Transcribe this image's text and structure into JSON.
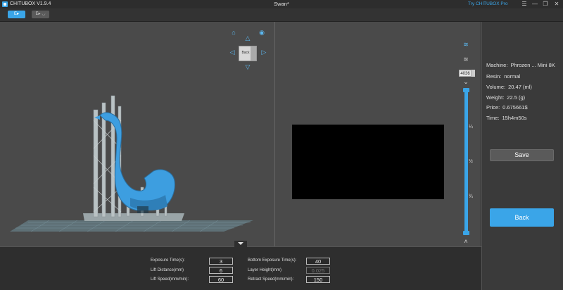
{
  "titlebar": {
    "app_name": "CHITUBOX V1.9.4",
    "doc_title": "Swan*",
    "try_pro": "Try CHITUBOX Pro",
    "menu_icon": "☰",
    "minimize_icon": "—",
    "maximize_icon": "❐",
    "close_icon": "✕"
  },
  "toolbar": {
    "tab_edit": "E▸",
    "tab_slice": "E▸ ◡"
  },
  "viewport": {
    "view_cube_label": "Back",
    "accent_color": "#3aa5e8"
  },
  "preview": {
    "layer_value": "4036",
    "ticks": [
      "¼",
      "½",
      "¾"
    ]
  },
  "info": {
    "machine_label": "Machine:",
    "machine_value": "Phrozen ... Mini 8K",
    "resin_label": "Resin:",
    "resin_value": "normal",
    "volume_label": "Volume:",
    "volume_value": "20.47",
    "volume_unit": "(ml)",
    "weight_label": "Weight:",
    "weight_value": "22.5",
    "weight_unit": "(g)",
    "price_label": "Price:",
    "price_value": "0.675661$",
    "time_label": "Time:",
    "time_value": "15h4m50s",
    "save_label": "Save",
    "back_label": "Back"
  },
  "settings": {
    "exposure_time_label": "Exposure Time(s):",
    "exposure_time_value": "3",
    "lift_distance_label": "Lift Distance(mm)",
    "lift_distance_value": "6",
    "lift_speed_label": "Lift Speed(mm/min):",
    "lift_speed_value": "60",
    "bottom_exposure_label": "Bottom Exposure Time(s):",
    "bottom_exposure_value": "40",
    "layer_height_label": "Layer Height(mm)",
    "layer_height_value": "0.025",
    "retract_speed_label": "Retract Speed(mm/min):",
    "retract_speed_value": "150"
  }
}
